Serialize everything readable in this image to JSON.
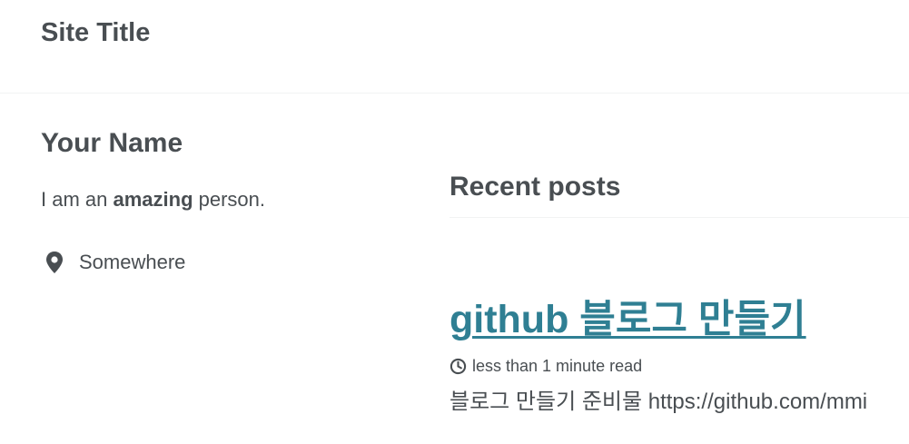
{
  "masthead": {
    "site_title": "Site Title"
  },
  "author": {
    "name": "Your Name",
    "bio_prefix": "I am an ",
    "bio_bold": "amazing",
    "bio_suffix": " person.",
    "location": "Somewhere",
    "location_icon": "map-marker-icon"
  },
  "main": {
    "section_title": "Recent posts",
    "posts": [
      {
        "title": "github 블로그 만들기",
        "read_time": "less than 1 minute read",
        "read_time_icon": "clock-icon",
        "excerpt": "블로그 만들기 준비물 https://github.com/mmi"
      }
    ]
  },
  "colors": {
    "text": "#494e52",
    "link": "#2f7f93",
    "border": "#f2f3f3"
  }
}
